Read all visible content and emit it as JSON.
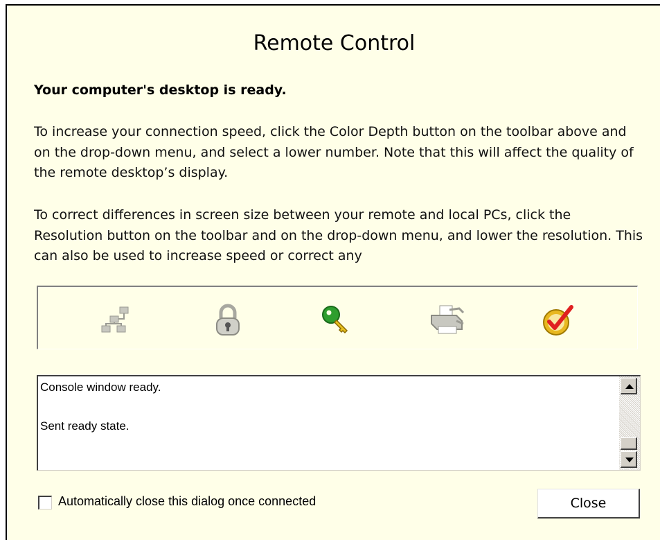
{
  "dialog": {
    "title": "Remote Control",
    "heading": "Your computer's desktop is ready.",
    "paragraphs": [
      "To increase your connection speed, click the Color Depth button on the toolbar above and on the drop-down menu, and select a lower number. Note that this will affect the quality of the remote desktop’s display.",
      "To correct differences in screen size between your remote and local PCs, click the Resolution button on the toolbar and on the drop-down menu, and lower the resolution. This can also be used to increase speed or correct any"
    ]
  },
  "status_icons": [
    {
      "icon": "network-icon",
      "state": "disabled"
    },
    {
      "icon": "padlock-icon",
      "state": "disabled"
    },
    {
      "icon": "key-icon",
      "state": "active",
      "color": "#2e9e2e"
    },
    {
      "icon": "printer-icon",
      "state": "disabled"
    },
    {
      "icon": "checkmark-icon",
      "state": "active",
      "color": "#e02020"
    }
  ],
  "log": {
    "lines": [
      "Console window ready.",
      "Sent ready state."
    ]
  },
  "footer": {
    "checkbox_label": "Automatically close this dialog once connected",
    "checkbox_checked": false,
    "close_label": "Close"
  }
}
